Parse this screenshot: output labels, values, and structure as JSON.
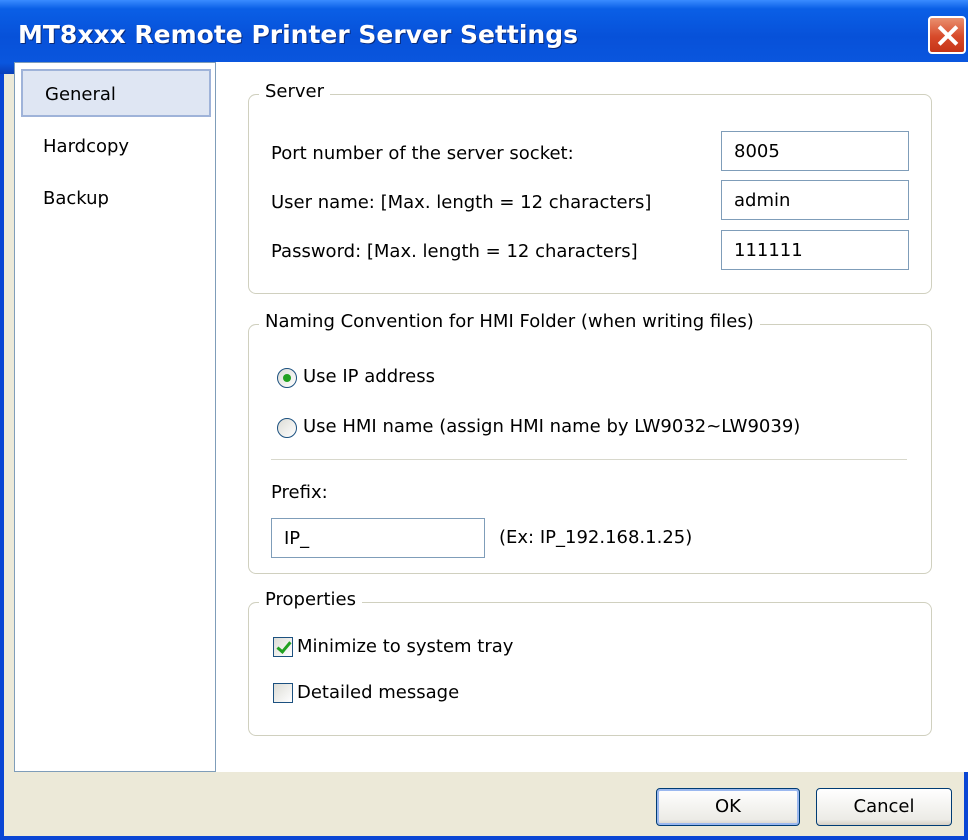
{
  "window": {
    "title": "MT8xxx Remote Printer Server Settings"
  },
  "sidebar": {
    "items": [
      {
        "label": "General",
        "selected": true
      },
      {
        "label": "Hardcopy"
      },
      {
        "label": "Backup"
      }
    ]
  },
  "server": {
    "title": "Server",
    "port_label": "Port number of the server socket:",
    "port_value": "8005",
    "user_label": "User name: [Max. length = 12 characters]",
    "user_value": "admin",
    "password_label": "Password: [Max. length = 12 characters]",
    "password_value": "111111"
  },
  "naming": {
    "title": "Naming Convention for HMI Folder (when writing files)",
    "option_ip": "Use IP address",
    "option_hmi": "Use HMI name (assign HMI name by LW9032~LW9039)",
    "selected": "ip",
    "prefix_label": "Prefix:",
    "prefix_value": "IP_",
    "example": "(Ex: IP_192.168.1.25)"
  },
  "properties": {
    "title": "Properties",
    "minimize_label": "Minimize to system tray",
    "minimize_checked": true,
    "detailed_label": "Detailed message",
    "detailed_checked": false
  },
  "buttons": {
    "ok": "OK",
    "cancel": "Cancel"
  },
  "colors": {
    "titlebar": "#0751d9",
    "close": "#d74a2a",
    "dialog_bg": "#ece9d8",
    "check_accent": "#21a121"
  }
}
